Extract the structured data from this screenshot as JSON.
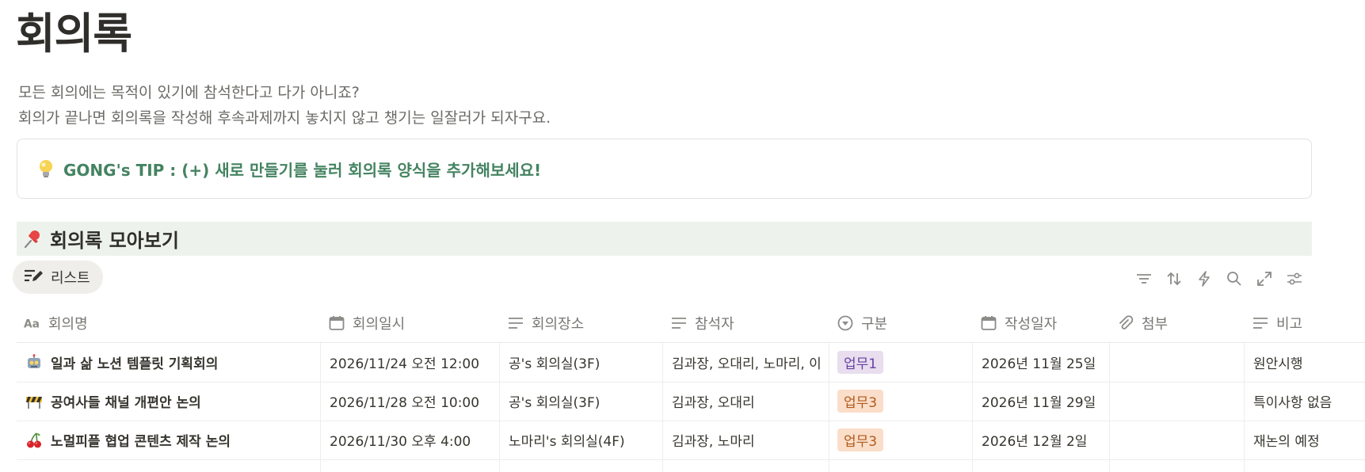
{
  "page": {
    "title": "회의록",
    "description_lines": [
      "모든 회의에는 목적이 있기에 참석한다고 다가 아니죠?",
      "회의가 끝나면 회의록을 작성해 후속과제까지 놓치지 않고 챙기는 일잘러가 되자구요."
    ]
  },
  "callout": {
    "icon": "lightbulb-icon",
    "text": "GONG's TIP : (+) 새로 만들기를 눌러 회의록 양식을 추가해보세요!"
  },
  "section": {
    "icon": "pushpin-icon",
    "title": "회의록 모아보기"
  },
  "view": {
    "tab_label": "리스트",
    "tab_icon": "list-edit-icon"
  },
  "toolbar": [
    "filter-icon",
    "sort-icon",
    "lightning-icon",
    "search-icon",
    "expand-icon",
    "settings-icon"
  ],
  "columns": [
    {
      "label": "회의명",
      "icon": "text-type-icon"
    },
    {
      "label": "회의일시",
      "icon": "calendar-icon"
    },
    {
      "label": "회의장소",
      "icon": "text-lines-icon"
    },
    {
      "label": "참석자",
      "icon": "text-lines-icon"
    },
    {
      "label": "구분",
      "icon": "select-icon"
    },
    {
      "label": "작성일자",
      "icon": "calendar-icon"
    },
    {
      "label": "첨부",
      "icon": "attachment-icon"
    },
    {
      "label": "비고",
      "icon": "text-lines-icon"
    }
  ],
  "rows": [
    {
      "emoji": "robot-icon",
      "name": "일과 삶 노션 템플릿 기획회의",
      "datetime": "2026/11/24 오전 12:00",
      "place": "공's 회의실(3F)",
      "attendees": "김과장, 오대리, 노마리, 이",
      "category": "업무1",
      "written": "2026년 11월 25일",
      "attach": "",
      "note": "원안시행"
    },
    {
      "emoji": "barrier-icon",
      "name": "공여사들 채널 개편안 논의",
      "datetime": "2026/11/28 오전 10:00",
      "place": "공's 회의실(3F)",
      "attendees": "김과장, 오대리",
      "category": "업무3",
      "written": "2026년 11월 29일",
      "attach": "",
      "note": "특이사항 없음"
    },
    {
      "emoji": "cherry-icon",
      "name": "노멀피플 협업 콘텐츠 제작 논의",
      "datetime": "2026/11/30 오후 4:00",
      "place": "노마리's 회의실(4F)",
      "attendees": "김과장, 노마리",
      "category": "업무3",
      "written": "2026년 12월 2일",
      "attach": "",
      "note": "재논의 예정"
    }
  ],
  "colors": {
    "tip_green": "#448361",
    "section_bg": "#edf3ec",
    "tag_work1_bg": "#e8deee",
    "tag_work1_fg": "#6940a5",
    "tag_work3_bg": "#fadec9",
    "tag_work3_fg": "#b15a1d"
  }
}
